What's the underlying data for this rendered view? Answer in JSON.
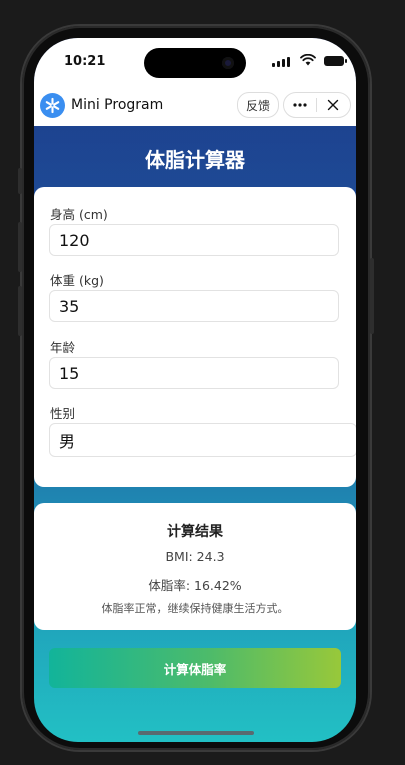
{
  "status_bar": {
    "time": "10:21"
  },
  "mini_program": {
    "title": "Mini Program",
    "feedback_label": "反馈",
    "more_icon": "more-dots-icon",
    "close_icon": "close-icon"
  },
  "page": {
    "title": "体脂计算器"
  },
  "form": {
    "height": {
      "label": "身高 (cm)",
      "value": "120"
    },
    "weight": {
      "label": "体重 (kg)",
      "value": "35"
    },
    "age": {
      "label": "年龄",
      "value": "15"
    },
    "gender": {
      "label": "性别",
      "value": "男"
    }
  },
  "result": {
    "title": "计算结果",
    "bmi": "BMI: 24.3",
    "body_fat": "体脂率: 16.42%",
    "advice": "体脂率正常，继续保持健康生活方式。"
  },
  "actions": {
    "calculate_label": "计算体脂率"
  },
  "colors": {
    "header_blue": "#1d3a8a",
    "gradient_bottom": "#22c0c4",
    "button_start": "#12b49a",
    "button_end": "#98c83a",
    "logo_blue": "#3a8ef0"
  }
}
